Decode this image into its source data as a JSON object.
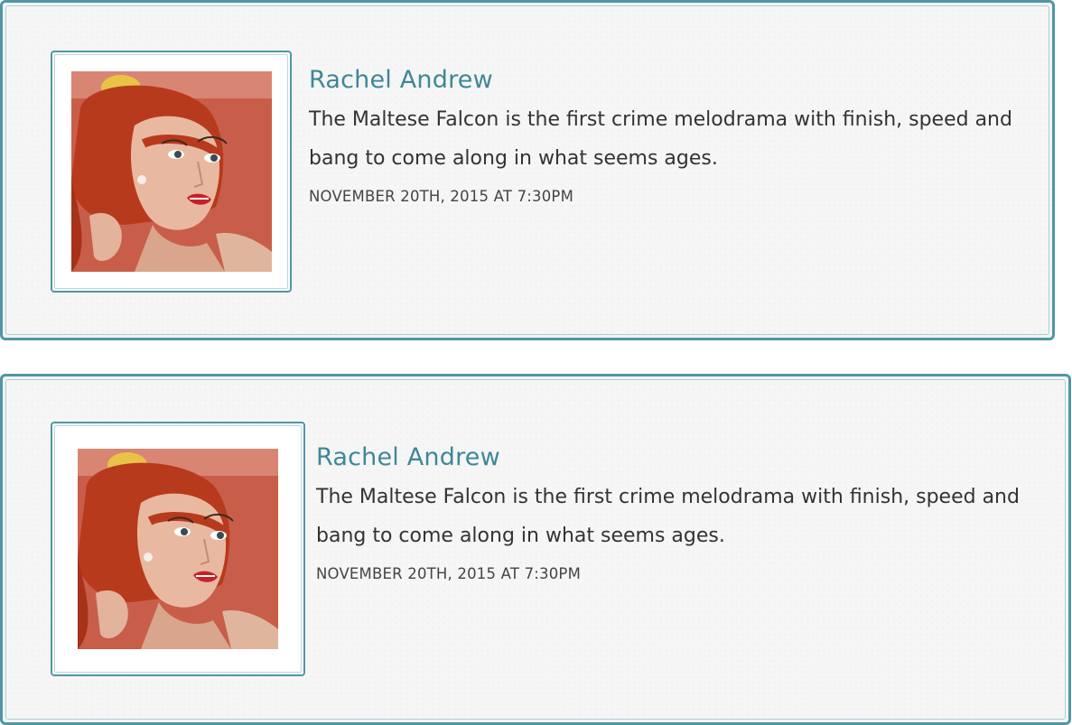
{
  "comments": [
    {
      "author": "Rachel Andrew",
      "text": "The Maltese Falcon is the first crime melodrama with finish, speed and bang to come along in what seems ages.",
      "date": "NOVEMBER 20TH, 2015 AT 7:30PM",
      "avatar_icon": "avatar-illustration"
    },
    {
      "author": "Rachel Andrew",
      "text": "The Maltese Falcon is the first crime melodrama with finish, speed and bang to come along in what seems ages.",
      "date": "NOVEMBER 20TH, 2015 AT 7:30PM",
      "avatar_icon": "avatar-illustration"
    }
  ],
  "colors": {
    "border": "#4f97a6",
    "author": "#3f8796",
    "text": "#333333",
    "background": "#f6f6f6"
  }
}
